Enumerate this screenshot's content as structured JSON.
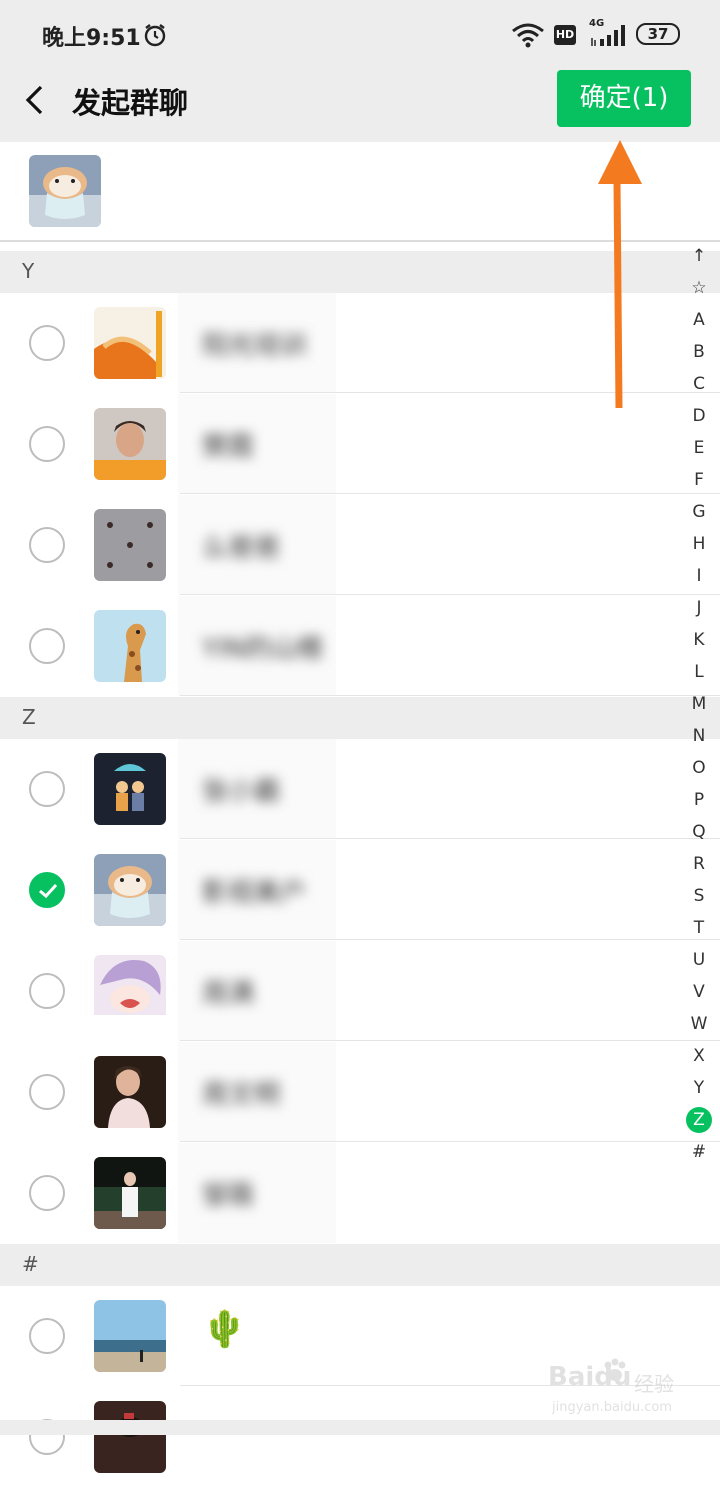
{
  "status_bar": {
    "time": "晚上9:51",
    "hd_label": "HD",
    "network_label": "4G",
    "battery": "37",
    "icons": [
      "alarm-icon",
      "wifi-icon",
      "signal-icon",
      "battery-icon"
    ]
  },
  "header": {
    "title": "发起群聊",
    "confirm_label": "确定(1)",
    "accent_color": "#07c160"
  },
  "sections": [
    {
      "letter": "Y"
    },
    {
      "letter": "Z"
    },
    {
      "letter": "#"
    }
  ],
  "contacts": [
    {
      "name": "阳光培训",
      "section": "Y",
      "selected": false,
      "avatar": "sun-logo"
    },
    {
      "name": "樊霞",
      "section": "Y",
      "selected": false,
      "avatar": "woman-photo"
    },
    {
      "name": "么爸爸",
      "section": "Y",
      "selected": false,
      "avatar": "pattern-photo"
    },
    {
      "name": "YIN的山楂",
      "section": "Y",
      "selected": false,
      "avatar": "giraffe-photo"
    },
    {
      "name": "张小霸",
      "section": "Z",
      "selected": false,
      "avatar": "couple-illustration"
    },
    {
      "name": "影视美户",
      "section": "Z",
      "selected": true,
      "avatar": "hamster-photo"
    },
    {
      "name": "周满",
      "section": "Z",
      "selected": false,
      "avatar": "anime-photo"
    },
    {
      "name": "周文明",
      "section": "Z",
      "selected": false,
      "avatar": "girl-photo"
    },
    {
      "name": "邹薇",
      "section": "Z",
      "selected": false,
      "avatar": "night-photo"
    },
    {
      "name": "🌵",
      "section": "#",
      "selected": false,
      "avatar": "beach-photo"
    }
  ],
  "index_bar": [
    "↑",
    "☆",
    "A",
    "B",
    "C",
    "D",
    "E",
    "F",
    "G",
    "H",
    "I",
    "J",
    "K",
    "L",
    "M",
    "N",
    "O",
    "P",
    "Q",
    "R",
    "S",
    "T",
    "U",
    "V",
    "W",
    "X",
    "Y",
    "Z",
    "#"
  ],
  "index_active": "Z",
  "watermark": {
    "logo": "Bai",
    "logo_suffix": "du",
    "text": "经验",
    "url": "jingyan.baidu.com"
  }
}
